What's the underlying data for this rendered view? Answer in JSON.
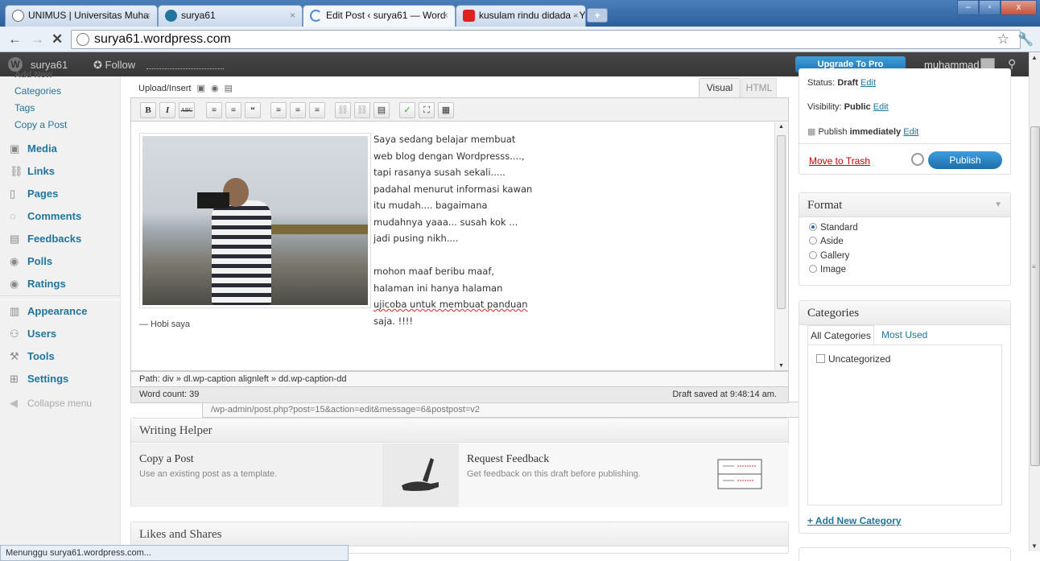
{
  "browser": {
    "tabs": [
      {
        "label": "UNIMUS | Universitas Muha",
        "icon": "globe-icon"
      },
      {
        "label": "surya61",
        "icon": "wordpress-icon"
      },
      {
        "label": "Edit Post ‹ surya61 — Word",
        "icon": "loading-icon"
      },
      {
        "label": "kusulam rindu didada - You",
        "icon": "youtube-icon"
      }
    ],
    "url_host": "surya61.wordpress.com",
    "url_path": "/wp-admin/post.php?post=15&action=edit&message=6&postpost=v2",
    "status": "Menunggu surya61.wordpress.com..."
  },
  "adminbar": {
    "site": "surya61",
    "follow": "Follow",
    "upgrade": "Upgrade To Pro",
    "user": "muhammad"
  },
  "sidebar": {
    "cut_item": "Add New",
    "subitems": [
      "Categories",
      "Tags",
      "Copy a Post"
    ],
    "menu": [
      {
        "label": "Media",
        "icon": "media-icon"
      },
      {
        "label": "Links",
        "icon": "links-icon"
      },
      {
        "label": "Pages",
        "icon": "pages-icon"
      },
      {
        "label": "Comments",
        "icon": "comments-icon"
      },
      {
        "label": "Feedbacks",
        "icon": "feedbacks-icon"
      },
      {
        "label": "Polls",
        "icon": "polls-icon"
      },
      {
        "label": "Ratings",
        "icon": "ratings-icon"
      },
      {
        "label": "Appearance",
        "icon": "appearance-icon"
      },
      {
        "label": "Users",
        "icon": "users-icon"
      },
      {
        "label": "Tools",
        "icon": "tools-icon"
      },
      {
        "label": "Settings",
        "icon": "settings-icon"
      }
    ],
    "collapse": "Collapse menu"
  },
  "editor": {
    "upload_label": "Upload/Insert",
    "tab_visual": "Visual",
    "tab_html": "HTML",
    "toolbar_buttons": [
      "B",
      "I",
      "ABC",
      "≡",
      "≡",
      "“",
      "≡",
      "≡",
      "≡",
      "⛓",
      "⛓",
      "▤",
      "✓",
      "⛶",
      "▦"
    ],
    "caption": "— Hobi saya",
    "content_lines": [
      "Saya sedang belajar membuat",
      "web blog dengan Wordpresss....,",
      "tapi rasanya susah sekali.....",
      "padahal menurut informasi kawan",
      "itu mudah.... bagaimana",
      "mudahnya yaaa... susah kok ...",
      "jadi pusing nikh....",
      "",
      "mohon maaf beribu maaf,",
      "halaman ini hanya halaman",
      "ujicoba untuk membuat panduan",
      "saja. !!!!"
    ],
    "path": "Path: div » dl.wp-caption alignleft » dd.wp-caption-dd",
    "word_count": "Word count: 39",
    "draft_saved": "Draft saved at 9:48:14 am."
  },
  "writing_helper": {
    "title": "Writing Helper",
    "copy_title": "Copy a Post",
    "copy_desc": "Use an existing post as a template.",
    "feedback_title": "Request Feedback",
    "feedback_desc": "Get feedback on this draft before publishing."
  },
  "likes": {
    "title": "Likes and Shares"
  },
  "publish": {
    "status_label": "Status:",
    "status_value": "Draft",
    "visibility_label": "Visibility:",
    "visibility_value": "Public",
    "publish_label": "Publish",
    "publish_when": "immediately",
    "edit": "Edit",
    "trash": "Move to Trash",
    "button": "Publish"
  },
  "format": {
    "title": "Format",
    "options": [
      "Standard",
      "Aside",
      "Gallery",
      "Image"
    ],
    "selected": "Standard"
  },
  "categories": {
    "title": "Categories",
    "tab_all": "All Categories",
    "tab_used": "Most Used",
    "items": [
      "Uncategorized"
    ],
    "add_new": "+ Add New Category"
  }
}
